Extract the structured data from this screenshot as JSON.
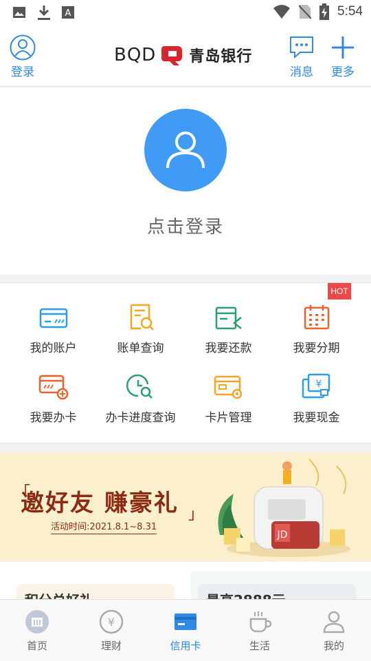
{
  "status_bar": {
    "time": "5:54",
    "left_icons": [
      "image-icon",
      "download-icon",
      "a-icon"
    ],
    "right_icons": [
      "wifi-icon",
      "no-sim-icon",
      "battery-charging-icon"
    ]
  },
  "header": {
    "login_label": "登录",
    "logo_text": "BQD",
    "bank_name": "青岛银行",
    "messages_label": "消息",
    "more_label": "更多",
    "accent_color": "#2f89e8"
  },
  "login_card": {
    "prompt": "点击登录",
    "avatar_color": "#3f9bf5"
  },
  "grid": {
    "hot_badge": "HOT",
    "items": [
      {
        "label": "我的账户",
        "icon": "account-card-icon",
        "color": "#2c9be8"
      },
      {
        "label": "账单查询",
        "icon": "bill-search-icon",
        "color": "#f5a623"
      },
      {
        "label": "我要还款",
        "icon": "repay-icon",
        "color": "#27a06c"
      },
      {
        "label": "我要分期",
        "icon": "calendar-icon",
        "color": "#f0602a"
      },
      {
        "label": "我要办卡",
        "icon": "apply-card-icon",
        "color": "#f0602a"
      },
      {
        "label": "办卡进度查询",
        "icon": "progress-search-icon",
        "color": "#27a06c"
      },
      {
        "label": "卡片管理",
        "icon": "card-settings-icon",
        "color": "#f5a623"
      },
      {
        "label": "我要现金",
        "icon": "cash-card-icon",
        "color": "#2c9be8"
      }
    ]
  },
  "banner": {
    "title": "邀好友 赚豪礼",
    "date": "活动时间:2021.8.1~8.31"
  },
  "cards": {
    "card1_title": "积分兑好礼",
    "card2_title": "最高2888元"
  },
  "tabbar": {
    "tabs": [
      {
        "label": "首页",
        "icon": "home-bank-icon"
      },
      {
        "label": "理财",
        "icon": "yuan-coin-icon"
      },
      {
        "label": "信用卡",
        "icon": "credit-card-icon",
        "active": true
      },
      {
        "label": "生活",
        "icon": "coffee-cup-icon"
      },
      {
        "label": "我的",
        "icon": "person-icon"
      }
    ]
  }
}
